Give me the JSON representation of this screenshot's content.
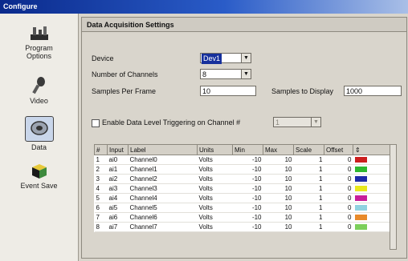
{
  "window": {
    "title": "Configure"
  },
  "sidebar": {
    "items": [
      {
        "label_1": "Program",
        "label_2": "Options",
        "icon": "tools-icon"
      },
      {
        "label_1": "Video",
        "label_2": "",
        "icon": "microphone-icon"
      },
      {
        "label_1": "Data",
        "label_2": "",
        "icon": "data-disk-icon",
        "selected": true
      },
      {
        "label_1": "Event Save",
        "label_2": "",
        "icon": "cube-icon"
      }
    ]
  },
  "panel": {
    "title": "Data Acquisition Settings",
    "device_label": "Device",
    "device_value": "Dev1",
    "channels_label": "Number of Channels",
    "channels_value": "8",
    "samples_frame_label": "Samples Per Frame",
    "samples_frame_value": "10",
    "samples_display_label": "Samples to Display",
    "samples_display_value": "1000",
    "trigger_label": "Enable Data Level Triggering on Channel #",
    "trigger_value": "1",
    "trigger_enabled": false
  },
  "table": {
    "headers": [
      "#",
      "Input",
      "Label",
      "Units",
      "Min",
      "Max",
      "Scale",
      "Offset",
      ""
    ],
    "rows": [
      {
        "n": "1",
        "input": "ai0",
        "label": "Channel0",
        "units": "Volts",
        "min": "-10",
        "max": "10",
        "scale": "1",
        "offset": "0",
        "color": "#cc1f1f"
      },
      {
        "n": "2",
        "input": "ai1",
        "label": "Channel1",
        "units": "Volts",
        "min": "-10",
        "max": "10",
        "scale": "1",
        "offset": "0",
        "color": "#2fb82f"
      },
      {
        "n": "3",
        "input": "ai2",
        "label": "Channel2",
        "units": "Volts",
        "min": "-10",
        "max": "10",
        "scale": "1",
        "offset": "0",
        "color": "#1e2aa8"
      },
      {
        "n": "4",
        "input": "ai3",
        "label": "Channel3",
        "units": "Volts",
        "min": "-10",
        "max": "10",
        "scale": "1",
        "offset": "0",
        "color": "#e8e81e"
      },
      {
        "n": "5",
        "input": "ai4",
        "label": "Channel4",
        "units": "Volts",
        "min": "-10",
        "max": "10",
        "scale": "1",
        "offset": "0",
        "color": "#c81e9a"
      },
      {
        "n": "6",
        "input": "ai5",
        "label": "Channel5",
        "units": "Volts",
        "min": "-10",
        "max": "10",
        "scale": "1",
        "offset": "0",
        "color": "#8fd2e0"
      },
      {
        "n": "7",
        "input": "ai6",
        "label": "Channel6",
        "units": "Volts",
        "min": "-10",
        "max": "10",
        "scale": "1",
        "offset": "0",
        "color": "#e88a2a"
      },
      {
        "n": "8",
        "input": "ai7",
        "label": "Channel7",
        "units": "Volts",
        "min": "-10",
        "max": "10",
        "scale": "1",
        "offset": "0",
        "color": "#7ccf5a"
      }
    ]
  }
}
